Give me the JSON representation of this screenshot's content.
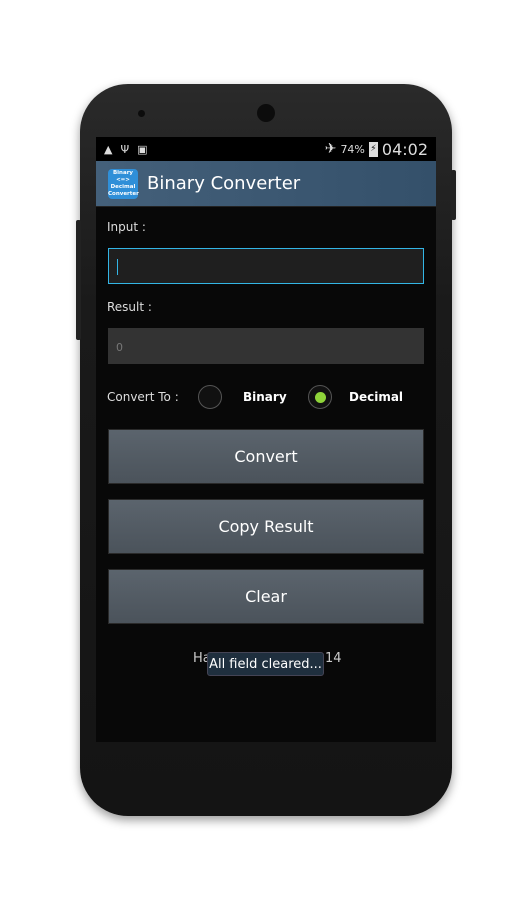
{
  "status_bar": {
    "battery": "74%",
    "time": "04:02",
    "icons": [
      "cleaner-icon",
      "usb-icon",
      "bbm-icon",
      "airplane-icon",
      "battery-charging-icon"
    ]
  },
  "app": {
    "title": "Binary Converter",
    "icon_lines": [
      "Binary",
      "<=>",
      "Decimal",
      "Converter"
    ]
  },
  "form": {
    "input_label": "Input :",
    "input_value": "",
    "result_label": "Result :",
    "result_value": "0",
    "convert_to_label": "Convert To :",
    "options": [
      {
        "label": "Binary",
        "selected": false
      },
      {
        "label": "Decimal",
        "selected": true
      }
    ]
  },
  "buttons": {
    "convert": "Convert",
    "copy": "Copy Result",
    "clear": "Clear"
  },
  "footer": {
    "left_fragment": "Ha",
    "right_fragment": "14"
  },
  "toast": "All field cleared...",
  "colors": {
    "accent": "#33b5e5",
    "radio_selected": "#8fd43a",
    "action_bar": "#3c586f"
  }
}
